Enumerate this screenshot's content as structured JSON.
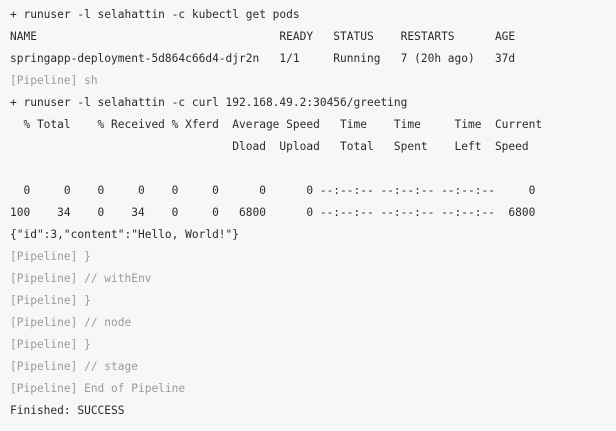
{
  "console": {
    "lines": [
      {
        "text": "+ runuser -l selahattin -c kubectl get pods",
        "dim": false
      },
      {
        "text": "NAME                                    READY   STATUS    RESTARTS      AGE",
        "dim": false
      },
      {
        "text": "springapp-deployment-5d864c66d4-djr2n   1/1     Running   7 (20h ago)   37d",
        "dim": false
      },
      {
        "text": "[Pipeline] sh",
        "dim": true
      },
      {
        "text": "+ runuser -l selahattin -c curl 192.168.49.2:30456/greeting",
        "dim": false
      },
      {
        "text": "  % Total    % Received % Xferd  Average Speed   Time    Time     Time  Current",
        "dim": false
      },
      {
        "text": "                                 Dload  Upload   Total   Spent    Left  Speed",
        "dim": false
      },
      {
        "text": "",
        "dim": false
      },
      {
        "text": "  0     0    0     0    0     0      0      0 --:--:-- --:--:-- --:--:--     0",
        "dim": false
      },
      {
        "text": "100    34    0    34    0     0   6800      0 --:--:-- --:--:-- --:--:--  6800",
        "dim": false
      },
      {
        "text": "{\"id\":3,\"content\":\"Hello, World!\"}",
        "dim": false
      },
      {
        "text": "[Pipeline] }",
        "dim": true
      },
      {
        "text": "[Pipeline] // withEnv",
        "dim": true
      },
      {
        "text": "[Pipeline] }",
        "dim": true
      },
      {
        "text": "[Pipeline] // node",
        "dim": true
      },
      {
        "text": "[Pipeline] }",
        "dim": true
      },
      {
        "text": "[Pipeline] // stage",
        "dim": true
      },
      {
        "text": "[Pipeline] End of Pipeline",
        "dim": true
      },
      {
        "text": "Finished: SUCCESS",
        "dim": false
      }
    ]
  },
  "colors": {
    "background": "#f7f7f7",
    "text": "#2b2b2b",
    "pipeline_text": "#9a9a9a"
  }
}
